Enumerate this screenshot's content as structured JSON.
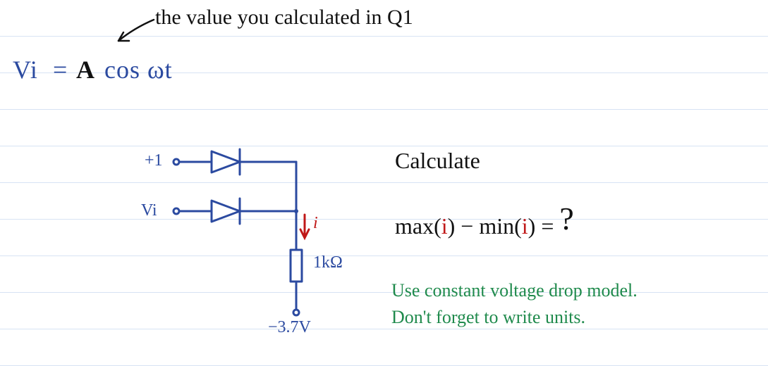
{
  "note_top": "the value you calculated in Q1",
  "equation": {
    "lhs": "Vi",
    "eq": "=",
    "A": "A",
    "rest": "cos ωt"
  },
  "circuit": {
    "src_top": "+1",
    "src_bot": "Vi",
    "current_label": "i",
    "resistor": "1kΩ",
    "supply": "−3.7V"
  },
  "task": {
    "header": "Calculate",
    "expr_max": "max(",
    "expr_i1": "i",
    "expr_mid": ") − min(",
    "expr_i2": "i",
    "expr_end": ") =",
    "qmark": "?"
  },
  "hints": {
    "line1": "Use constant voltage drop model.",
    "line2": "Don't forget to write units."
  }
}
